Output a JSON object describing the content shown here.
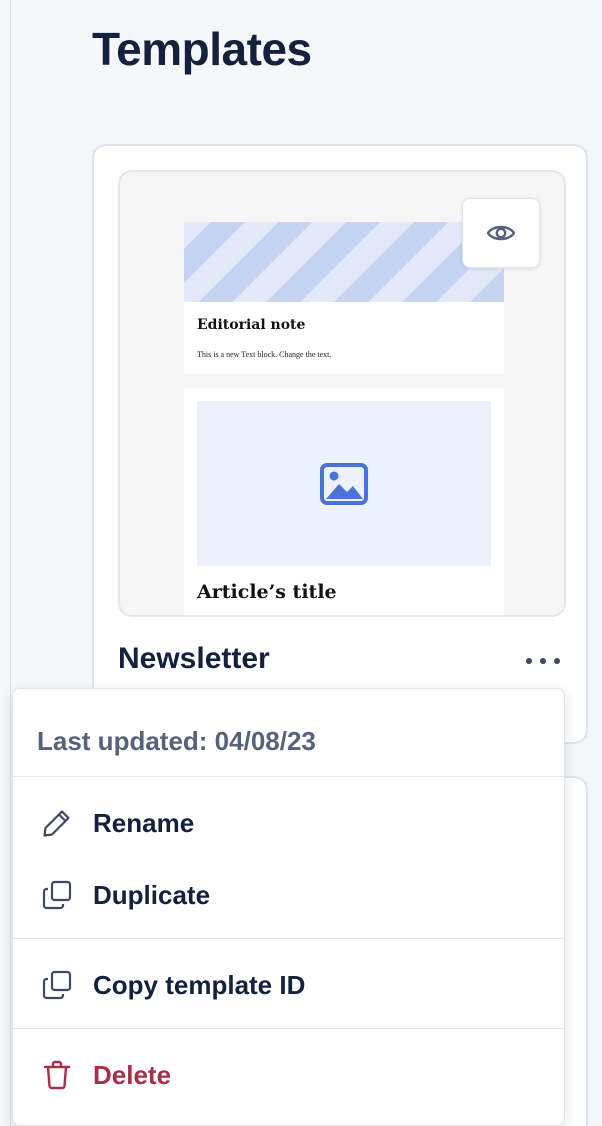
{
  "page": {
    "title": "Templates"
  },
  "template_card": {
    "name": "Newsletter",
    "preview": {
      "editorial_title": "Editorial note",
      "editorial_body": "This is a new Text block. Change the text.",
      "article_title": "Article’s title"
    },
    "preview_icon": "eye-icon",
    "more_icon": "more-horizontal-icon"
  },
  "context_menu": {
    "last_updated": "Last updated: 04/08/23",
    "items": [
      {
        "label": "Rename",
        "icon": "pencil-icon"
      },
      {
        "label": "Duplicate",
        "icon": "duplicate-icon"
      },
      {
        "label": "Copy template ID",
        "icon": "copy-icon"
      },
      {
        "label": "Delete",
        "icon": "trash-icon"
      }
    ]
  },
  "colors": {
    "text_primary": "#14213d",
    "text_muted": "#56627a",
    "danger": "#a5304a",
    "accent": "#4a72d9",
    "background": "#f5f7fb"
  }
}
